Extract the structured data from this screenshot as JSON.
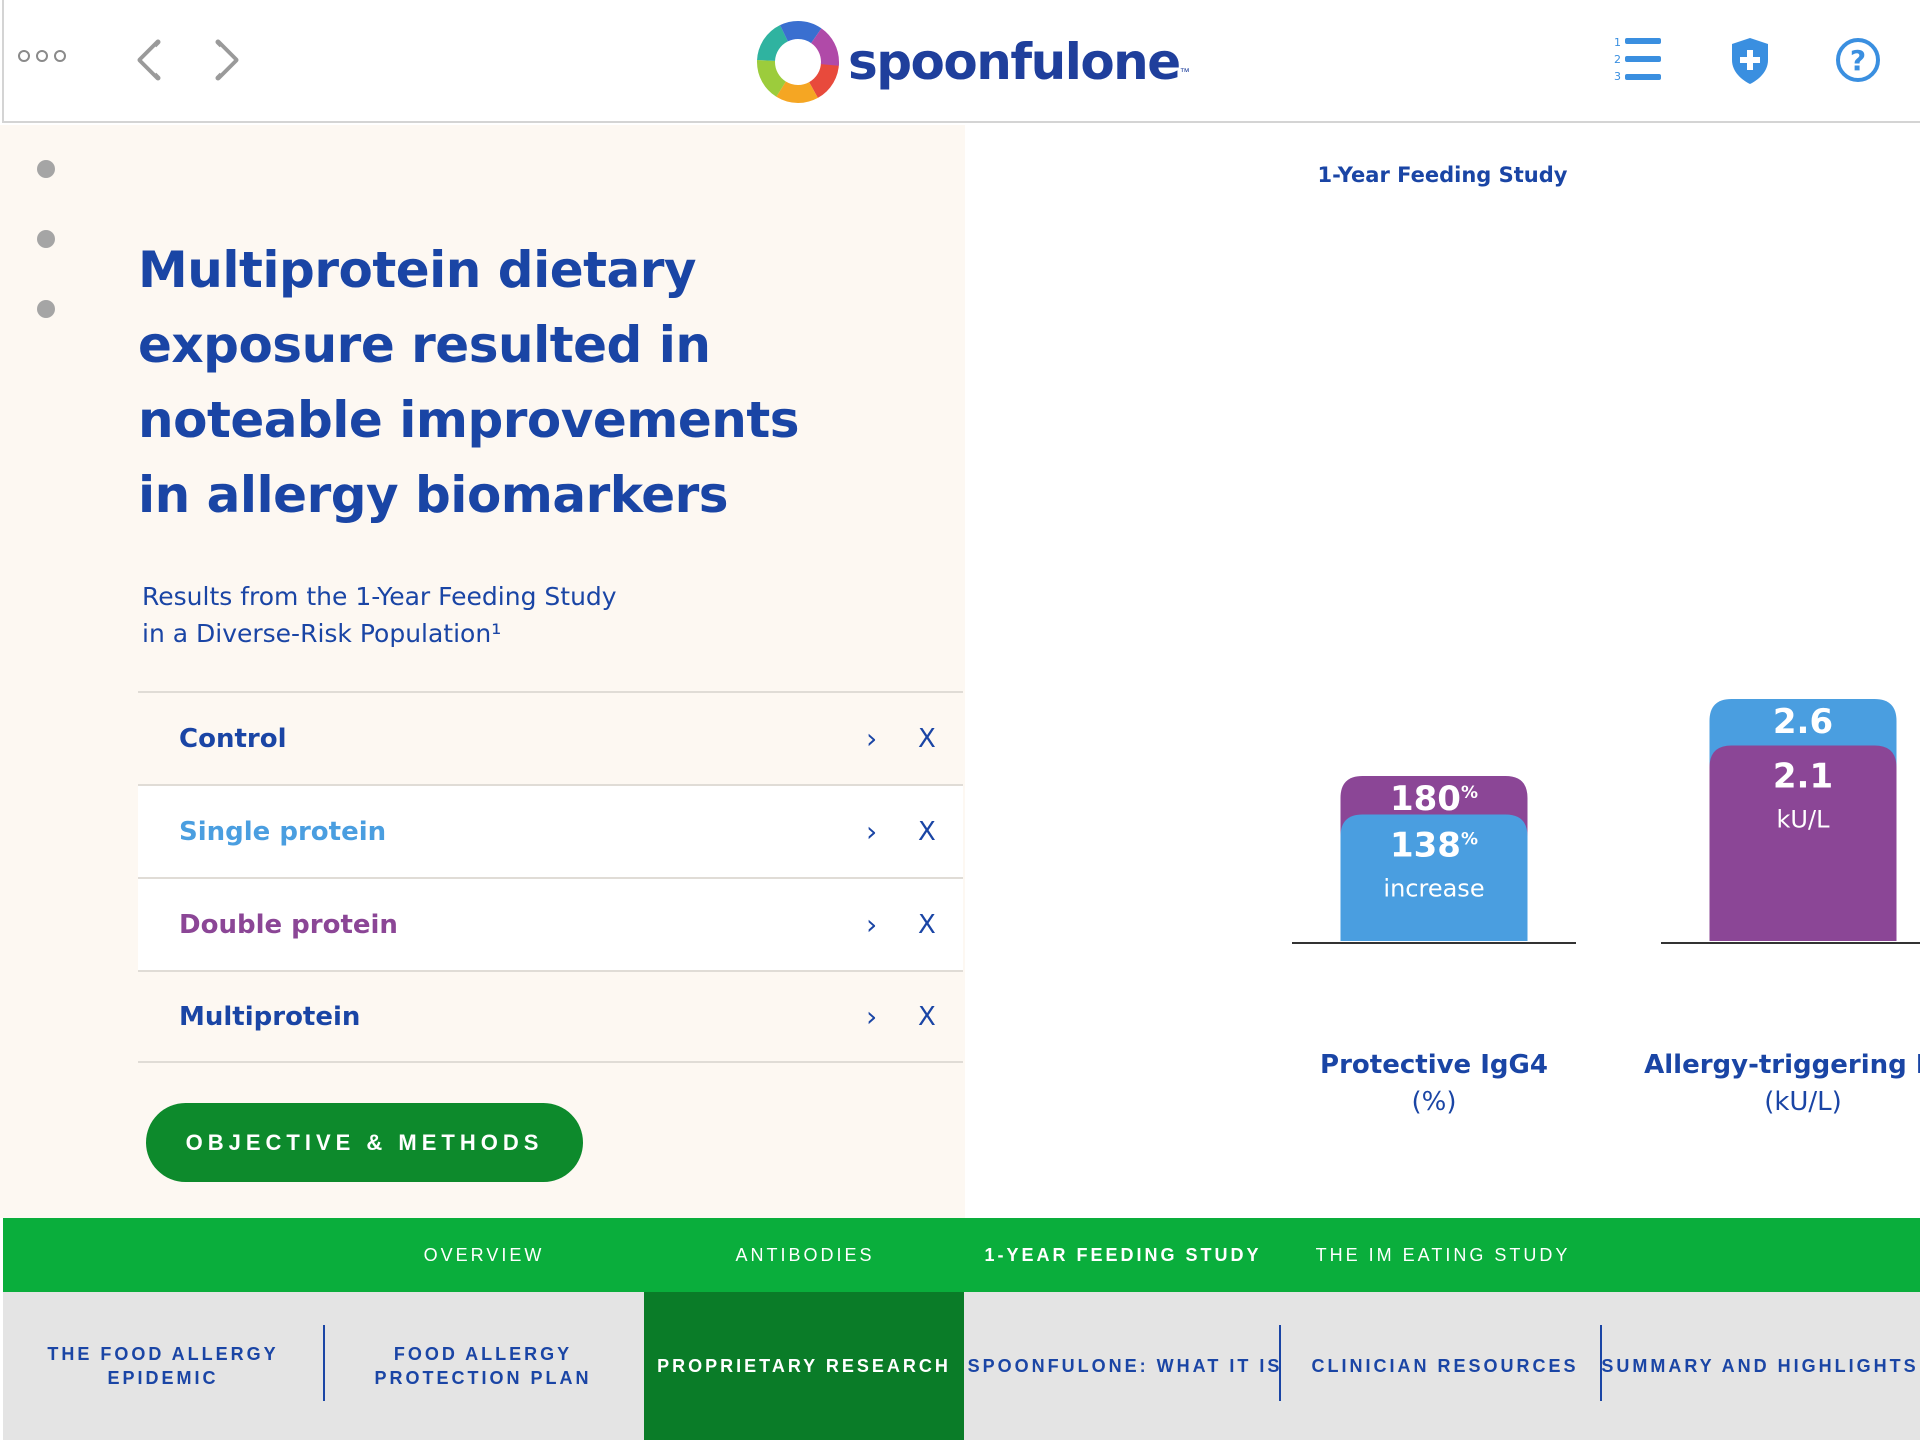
{
  "app": {
    "logo_text": "spoonfulone",
    "logo_tm": "™"
  },
  "header": {
    "icons": [
      "more-dots-icon",
      "back-arrow-icon",
      "forward-arrow-icon",
      "numbered-list-icon",
      "shield-plus-icon",
      "help-icon"
    ]
  },
  "left": {
    "headline": "Multiprotein dietary exposure resulted in noteable improvements in allergy biomarkers",
    "subhead_line1": "Results from the 1-Year Feeding Study",
    "subhead_line2": "in a Diverse-Risk Population¹",
    "legend": [
      {
        "label": "Control",
        "color": "#1a45a5",
        "chevron": "›",
        "close": "X"
      },
      {
        "label": "Single protein",
        "color": "#4a9ee0",
        "chevron": "›",
        "close": "X"
      },
      {
        "label": "Double protein",
        "color": "#8b4696",
        "chevron": "›",
        "close": "X"
      },
      {
        "label": "Multiprotein",
        "color": "#1a45a5",
        "chevron": "›",
        "close": "X"
      }
    ],
    "button_label": "OBJECTIVE & METHODS"
  },
  "chart_data": {
    "type": "bar",
    "title": "1-Year Feeding Study",
    "categories": [
      "Protective IgG4",
      "Allergy-triggering IgE"
    ],
    "category_units": [
      "(%)",
      "(kU/L)"
    ],
    "series": [
      {
        "name": "Double protein",
        "color": "#8b4696",
        "values": [
          180,
          2.1
        ],
        "labels": [
          "180",
          "2.1"
        ]
      },
      {
        "name": "Single protein",
        "color": "#4a9ee0",
        "values": [
          138,
          2.6
        ],
        "labels": [
          "138",
          "2.6"
        ]
      }
    ],
    "sublabels": [
      "increase",
      "kU/L"
    ],
    "percent_sign": "%"
  },
  "subnav": {
    "items": [
      {
        "label": "OVERVIEW",
        "active": false
      },
      {
        "label": "ANTIBODIES",
        "active": false
      },
      {
        "label": "1-YEAR FEEDING STUDY",
        "active": true
      },
      {
        "label": "THE IM EATING STUDY",
        "active": false
      }
    ]
  },
  "mainnav": {
    "items": [
      {
        "label": "THE FOOD ALLERGY EPIDEMIC",
        "active": false
      },
      {
        "label": "FOOD ALLERGY PROTECTION PLAN",
        "active": false
      },
      {
        "label": "PROPRIETARY RESEARCH",
        "active": true
      },
      {
        "label": "SPOONFULONE: WHAT IT IS",
        "active": false
      },
      {
        "label": "CLINICIAN RESOURCES",
        "active": false
      },
      {
        "label": "SUMMARY AND HIGHLIGHTS",
        "active": false
      }
    ]
  },
  "colors": {
    "brand_blue": "#1a45a5",
    "light_blue": "#4a9ee0",
    "purple": "#8b4696",
    "green_bar": "#0aae3c",
    "green_dark": "#0a7c28",
    "button_green": "#0d8a2c"
  }
}
